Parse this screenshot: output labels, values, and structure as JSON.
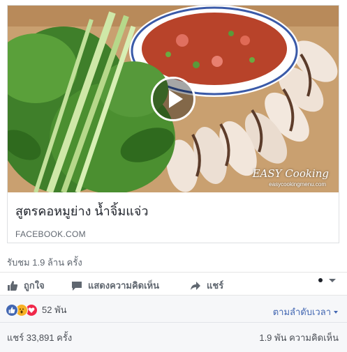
{
  "post": {
    "link_title": "สูตรคอหมูย่าง น้ำจิ้มแจ่ว",
    "link_domain": "FACEBOOK.COM",
    "watermark": "EASY Cooking",
    "watermark_sub": "easycookingmenu.com",
    "views": "รับชม 1.9 ล้าน ครั้ง"
  },
  "actions": {
    "like_label": "ถูกใจ",
    "comment_label": "แสดงความคิดเห็น",
    "share_label": "แชร์"
  },
  "summary": {
    "reaction_count": "52 พัน",
    "sort_label": "ตามลำดับเวลา",
    "shares": "แชร์ 33,891 ครั้ง",
    "comments": "1.9 พัน ความคิดเห็น"
  },
  "icons": [
    "play-icon",
    "like-icon",
    "comment-icon",
    "share-icon",
    "profile-dot-icon",
    "caret-down-icon",
    "like-reaction-icon",
    "wow-reaction-icon",
    "love-reaction-icon"
  ],
  "colors": {
    "link": "#4267b2",
    "text": "#1d2129",
    "muted": "#606770",
    "summary_bg": "#f6f7f9"
  }
}
